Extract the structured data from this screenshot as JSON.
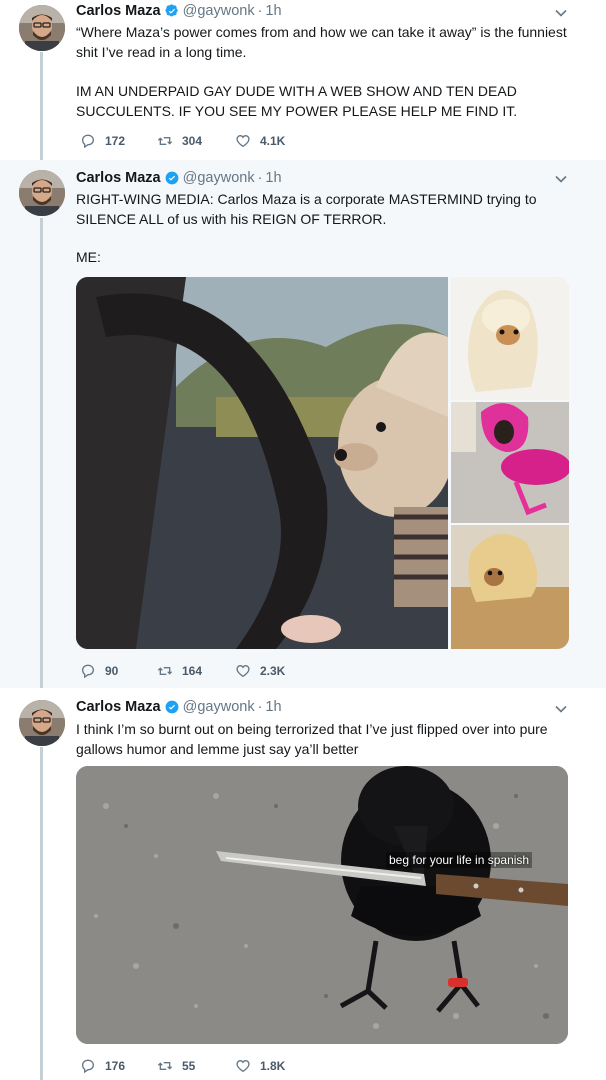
{
  "colors": {
    "verified": "#1da1f2",
    "text": "#14171a",
    "muted": "#657786",
    "thread_line": "#c4cfd6",
    "alt_bg": "#f5f8fa"
  },
  "tweets": [
    {
      "author": {
        "name": "Carlos Maza",
        "handle": "@gaywonk",
        "dot": "·",
        "time": "1h",
        "verified": true
      },
      "paragraphs": [
        "“Where Maza’s power comes from and how we can take it away” is the funniest shit I’ve read in a long time.",
        "IM AN UNDERPAID GAY DUDE WITH A WEB SHOW AND TEN DEAD SUCCULENTS. IF YOU SEE MY POWER PLEASE HELP ME FIND IT."
      ],
      "replies": "172",
      "retweets": "304",
      "likes": "4.1K"
    },
    {
      "author": {
        "name": "Carlos Maza",
        "handle": "@gaywonk",
        "dot": "·",
        "time": "1h",
        "verified": true
      },
      "paragraphs": [
        "RIGHT-WING MEDIA: Carlos Maza is a corporate MASTERMIND trying to SILENCE ALL of us with his REIGN OF TERROR.",
        "ME:"
      ],
      "replies": "90",
      "retweets": "164",
      "likes": "2.3K"
    },
    {
      "author": {
        "name": "Carlos Maza",
        "handle": "@gaywonk",
        "dot": "·",
        "time": "1h",
        "verified": true
      },
      "paragraphs": [
        "I think I’m so burnt out on being terrorized that I’ve just flipped over into pure gallows humor and lemme just say ya’ll better"
      ],
      "image_caption": "beg for your life in spanish",
      "replies": "176",
      "retweets": "55",
      "likes": "1.8K"
    }
  ],
  "icons": {
    "reply": "reply-icon",
    "retweet": "retweet-icon",
    "like": "heart-icon",
    "verified": "verified-badge-icon",
    "more": "chevron-down-icon"
  }
}
